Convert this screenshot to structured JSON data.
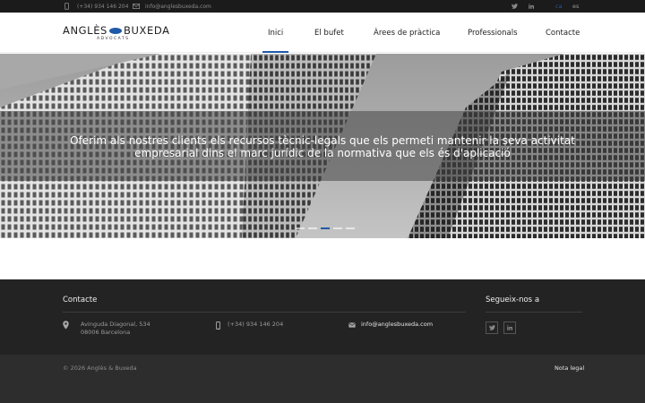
{
  "topbar": {
    "phone": "(+34) 934 146 204",
    "email": "info@anglesbuxeda.com",
    "languages": [
      "ca",
      "es"
    ],
    "active_language": "ca",
    "social_icons": [
      "twitter-icon",
      "linkedin-icon"
    ]
  },
  "header": {
    "logo_left": "ANGLÈS",
    "logo_right": "BUXEDA",
    "logo_sub": "ADVOCATS",
    "nav": [
      "Inici",
      "El bufet",
      "Àrees de pràctica",
      "Professionals",
      "Contacte"
    ],
    "active_nav": "Inici"
  },
  "hero": {
    "caption": "Oferim als nostres clients els recursos tècnic-legals que els permeti mantenir la seva activitat empresarial dins el marc jurídic de la normativa que els és d'aplicació",
    "slides": 5,
    "active_slide": 3
  },
  "footer": {
    "contact_title": "Contacte",
    "address_line1": "Avinguda Diagonal, 534",
    "address_line2": "08006 Barcelona",
    "phone": "(+34) 934 146 204",
    "email": "info@anglesbuxeda.com",
    "social_title": "Segueix-nos a",
    "copyright": "© 2026 Anglès & Buxeda",
    "legal": "Nota legal"
  },
  "colors": {
    "accent": "#1e5aa8",
    "topbar_bg": "#1b1b1b",
    "footer_bg": "#232323",
    "bottom_bg": "#2d2d2d"
  }
}
